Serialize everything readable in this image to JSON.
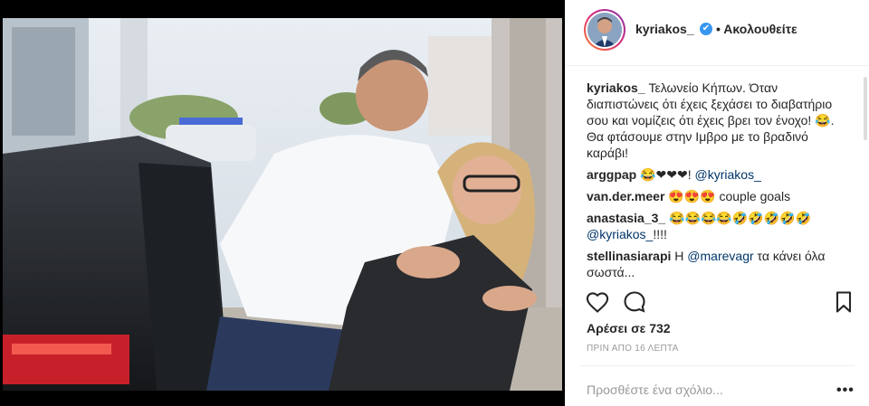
{
  "post": {
    "username": "kyriakos_",
    "verified_mark": "✔",
    "follow_status": "• Ακολουθείτε",
    "caption": {
      "user": "kyriakos_",
      "text": "Τελωνείο Κήπων. Όταν διαπιστώνεις ότι έχεις ξεχάσει το διαβατήριο σου και νομίζεις ότι έχεις βρει τον ένοχο! 😂. Θα φτάσουμε στην Ιμβρο με το βραδινό καράβι!"
    },
    "comments": [
      {
        "user": "arggpap",
        "text_before": "😂❤❤❤!",
        "mention": "@kyriakos_",
        "text_after": ""
      },
      {
        "user": "van.der.meer",
        "text_before": "😍😍😍 couple goals",
        "mention": "",
        "text_after": ""
      },
      {
        "user": "anastasia_3_",
        "text_before": "😂😂😂😂🤣🤣🤣🤣🤣",
        "mention": "@kyriakos_",
        "text_after": "!!!!"
      },
      {
        "user": "stellinasiarapi",
        "text_before": "Η",
        "mention": "@marevagr",
        "text_after": "τα κάνει όλα σωστά..."
      }
    ],
    "likes": "Αρέσει σε 732",
    "timestamp": "ΠΡΙΝ ΑΠΟ 16 ΛΕΠΤΑ",
    "comment_placeholder": "Προσθέστε ένα σχόλιο...",
    "more_options": "•••"
  },
  "icons": {
    "like": "heart-icon",
    "comment": "comment-icon",
    "save": "bookmark-icon",
    "verified": "verified-badge-icon"
  },
  "colors": {
    "text": "#262626",
    "muted": "#999999",
    "mention": "#003569",
    "verified": "#3897f0"
  }
}
